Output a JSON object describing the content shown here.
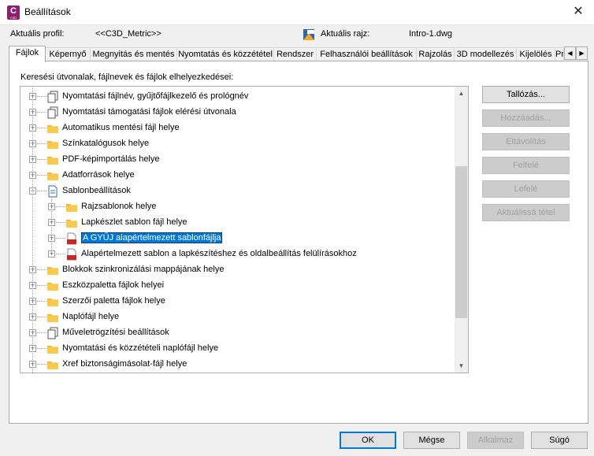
{
  "window": {
    "title": "Beállítások",
    "close_symbol": "✕",
    "app_icon_letter": "C",
    "app_icon_sub": "C3D"
  },
  "profile": {
    "label": "Aktuális profil:",
    "value": "<<C3D_Metric>>",
    "drawing_label": "Aktuális rajz:",
    "drawing_value": "Intro-1.dwg"
  },
  "tabs": [
    {
      "label": "Fájlok",
      "active": true
    },
    {
      "label": "Képernyő"
    },
    {
      "label": "Megnyitás és mentés"
    },
    {
      "label": "Nyomtatás és közzététel"
    },
    {
      "label": "Rendszer"
    },
    {
      "label": "Felhasználói beállítások"
    },
    {
      "label": "Rajzolás"
    },
    {
      "label": "3D modellezés"
    },
    {
      "label": "Kijelölés"
    },
    {
      "label": "Pr"
    }
  ],
  "tab_scroll": {
    "left": "◀",
    "right": "▶"
  },
  "files": {
    "header": "Keresési útvonalak, fájlnevek és fájlok elhelyezkedései:",
    "tree": [
      {
        "label": "Nyomtatási fájlnév, gyűjtőfájlkezelő és prológnév",
        "icon": "docs-icon",
        "level": 0
      },
      {
        "label": "Nyomtatási támogatási fájlok elérési útvonala",
        "icon": "docs-icon",
        "level": 0
      },
      {
        "label": "Automatikus mentési fájl helye",
        "icon": "folder-icon",
        "level": 0
      },
      {
        "label": "Színkatalógusok helye",
        "icon": "folder-icon",
        "level": 0
      },
      {
        "label": "PDF-képimportálás helye",
        "icon": "folder-icon",
        "level": 0
      },
      {
        "label": "Adatforrások helye",
        "icon": "folder-icon",
        "level": 0
      },
      {
        "label": "Sablonbeállítások",
        "icon": "doc-icon",
        "level": 0,
        "expanded": true
      },
      {
        "label": "Rajzsablonok helye",
        "icon": "folder-icon",
        "level": 1
      },
      {
        "label": "Lapkészlet sablon fájl helye",
        "icon": "folder-icon",
        "level": 1
      },
      {
        "label": "A GYŰJ alapértelmezett sablonfájlja",
        "icon": "dwt-file-icon",
        "level": 1,
        "selected": true
      },
      {
        "label": "Alapértelmezett sablon a lapkészítéshez és oldalbeállítás felülírásokhoz",
        "icon": "dwt-file-icon",
        "level": 1
      },
      {
        "label": "Blokkok szinkronizálási mappájának helye",
        "icon": "folder-icon",
        "level": 0
      },
      {
        "label": "Eszközpaletta fájlok helyei",
        "icon": "folder-icon",
        "level": 0
      },
      {
        "label": "Szerzői paletta fájlok helye",
        "icon": "folder-icon",
        "level": 0
      },
      {
        "label": "Naplófájl helye",
        "icon": "folder-icon",
        "level": 0
      },
      {
        "label": "Műveletrögzítési beállítások",
        "icon": "docs-icon",
        "level": 0
      },
      {
        "label": "Nyomtatási és közzétételi naplófájl helye",
        "icon": "folder-icon",
        "level": 0
      },
      {
        "label": "Xref biztonságimásolat-fájl helye",
        "icon": "folder-icon",
        "level": 0
      }
    ],
    "buttons": [
      {
        "label": "Tallózás...",
        "enabled": true
      },
      {
        "label": "Hozzáadás...",
        "enabled": false
      },
      {
        "label": "Eltávolítás",
        "enabled": false
      },
      {
        "label": "Felfelé",
        "enabled": false
      },
      {
        "label": "Lefelé",
        "enabled": false
      },
      {
        "label": "Aktuálissá tétel",
        "enabled": false
      }
    ]
  },
  "scroll": {
    "up": "▲",
    "down": "▼"
  },
  "footer": {
    "ok": "OK",
    "cancel": "Mégse",
    "apply": "Alkalmaz",
    "help": "Súgó"
  },
  "colors": {
    "selection": "#0078d7",
    "folder": "#f5b830",
    "app_icon": "#8e1f6f",
    "dwt_red": "#c62828"
  }
}
